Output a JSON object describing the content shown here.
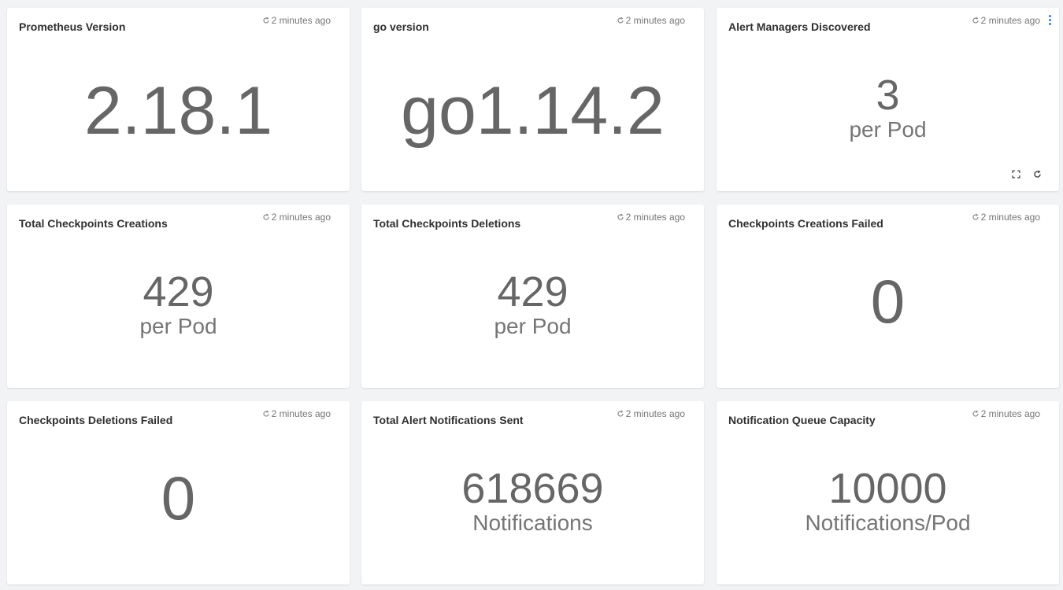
{
  "cards": [
    {
      "title": "Prometheus Version",
      "refresh": "2 minutes ago",
      "value": "2.18.1",
      "unit": ""
    },
    {
      "title": "go version",
      "refresh": "2 minutes ago",
      "value": "go1.14.2",
      "unit": ""
    },
    {
      "title": "Alert Managers Discovered",
      "refresh": "2 minutes ago",
      "value": "3",
      "unit": "per Pod"
    },
    {
      "title": "Total Checkpoints Creations",
      "refresh": "2 minutes ago",
      "value": "429",
      "unit": "per Pod"
    },
    {
      "title": "Total Checkpoints Deletions",
      "refresh": "2 minutes ago",
      "value": "429",
      "unit": "per Pod"
    },
    {
      "title": "Checkpoints Creations Failed",
      "refresh": "2 minutes ago",
      "value": "0",
      "unit": ""
    },
    {
      "title": "Checkpoints Deletions Failed",
      "refresh": "2 minutes ago",
      "value": "0",
      "unit": ""
    },
    {
      "title": "Total Alert Notifications Sent",
      "refresh": "2 minutes ago",
      "value": "618669",
      "unit": "Notifications"
    },
    {
      "title": "Notification Queue Capacity",
      "refresh": "2 minutes ago",
      "value": "10000",
      "unit": "Notifications/Pod"
    }
  ],
  "icons": {
    "refresh": "refresh-icon",
    "menu": "more-vertical-icon",
    "fullscreen": "fullscreen-icon",
    "reload": "reload-icon"
  },
  "colors": {
    "accent": "#3a7fd5",
    "value_text": "#666666",
    "title_text": "#2f2f2f",
    "background": "#f1f3f4"
  }
}
